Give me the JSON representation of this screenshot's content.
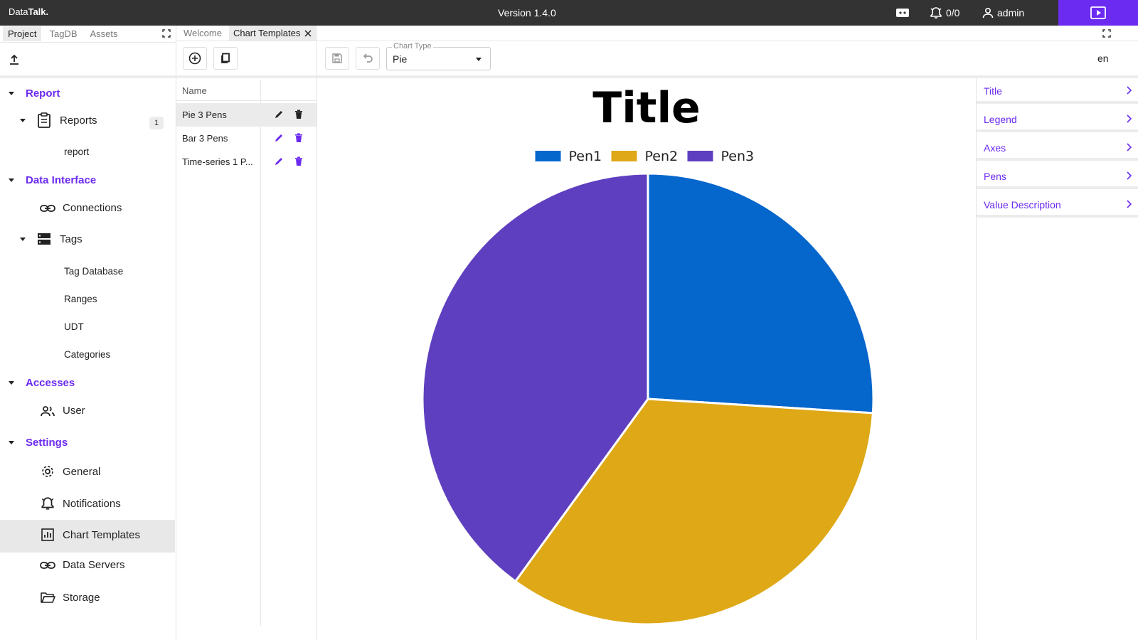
{
  "topbar": {
    "brand_prefix": "Data",
    "brand_bold": "Talk.",
    "version": "Version 1.4.0",
    "notifications": "0/0",
    "user": "admin"
  },
  "left_tabs": [
    "Project",
    "TagDB",
    "Assets"
  ],
  "tree": {
    "report_section": "Report",
    "reports": "Reports",
    "reports_count": "1",
    "report_item": "report",
    "data_interface_section": "Data Interface",
    "connections": "Connections",
    "tags": "Tags",
    "tag_database": "Tag Database",
    "ranges": "Ranges",
    "udt": "UDT",
    "categories": "Categories",
    "accesses_section": "Accesses",
    "user": "User",
    "settings_section": "Settings",
    "general": "General",
    "notifications": "Notifications",
    "chart_templates": "Chart Templates",
    "data_servers": "Data Servers",
    "storage": "Storage"
  },
  "doc_tabs": [
    "Welcome",
    "Chart Templates"
  ],
  "template_list": {
    "header": "Name",
    "rows": [
      "Pie 3 Pens",
      "Bar 3 Pens",
      "Time-series 1 P..."
    ]
  },
  "chart_type": {
    "label": "Chart Type",
    "value": "Pie"
  },
  "language": "en",
  "properties": [
    "Title",
    "Legend",
    "Axes",
    "Pens",
    "Value Description"
  ],
  "colors": {
    "accent": "#6c2bf0",
    "topbar": "#333333"
  },
  "chart_data": {
    "type": "pie",
    "title": "Title",
    "legend_position": "top",
    "series": [
      {
        "name": "Pen1",
        "value": 26,
        "color": "#0566cc"
      },
      {
        "name": "Pen2",
        "value": 34,
        "color": "#dea816"
      },
      {
        "name": "Pen3",
        "value": 40,
        "color": "#5e3fbf"
      }
    ]
  }
}
